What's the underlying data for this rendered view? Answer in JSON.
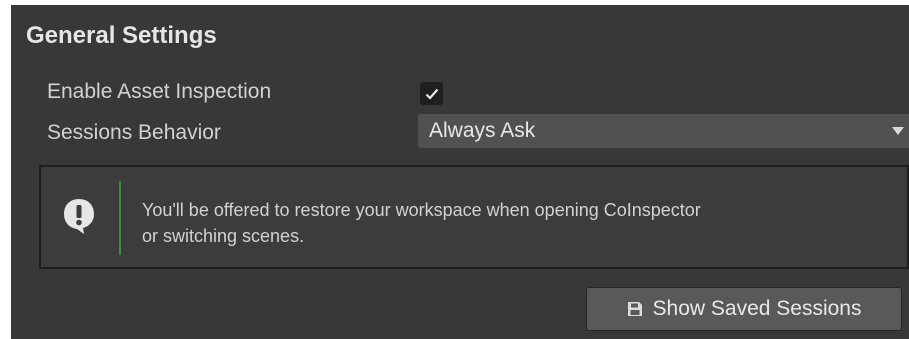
{
  "section": {
    "title": "General Settings"
  },
  "settings": {
    "asset_inspection": {
      "label": "Enable Asset Inspection",
      "checked": true
    },
    "sessions_behavior": {
      "label": "Sessions Behavior",
      "value": "Always Ask"
    }
  },
  "help": {
    "icon": "exclamation-speech-bubble-icon",
    "accent_color": "#3f8a3f",
    "line1": "You'll be offered to restore your workspace when opening CoInspector",
    "line2": "or switching scenes."
  },
  "actions": {
    "show_saved_sessions": {
      "label": "Show Saved Sessions",
      "icon": "floppy-disk-icon"
    }
  },
  "colors": {
    "panel_bg": "#383838",
    "field_bg": "#515151",
    "button_bg": "#595959"
  }
}
